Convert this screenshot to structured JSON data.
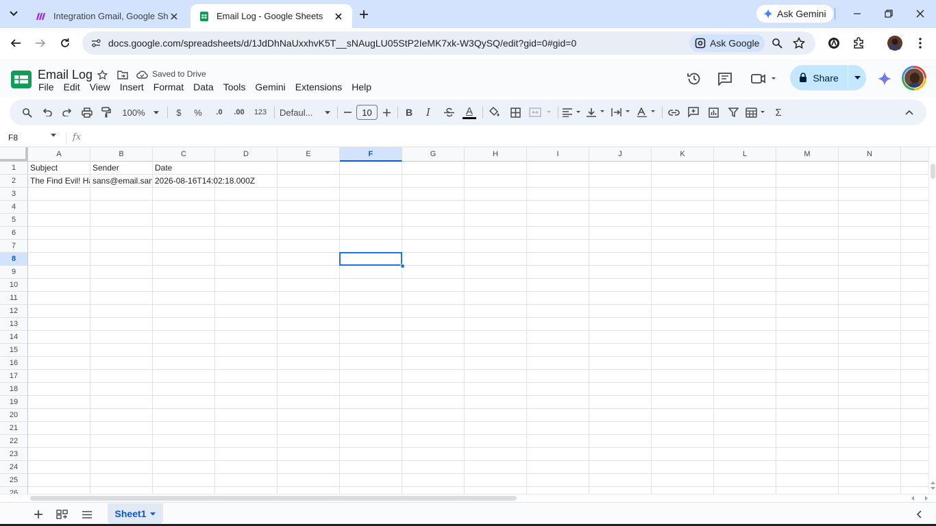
{
  "browser": {
    "tabs": [
      {
        "title": "Integration Gmail, Google Shee",
        "active": false
      },
      {
        "title": "Email Log - Google Sheets",
        "active": true
      }
    ],
    "ask_gemini": "Ask Gemini",
    "url": "docs.google.com/spreadsheets/d/1JdDhNaUxxhvK5T__sNAugLU05StP2IeMK7xk-W3QySQ/edit?gid=0#gid=0",
    "ask_google": "Ask Google"
  },
  "doc": {
    "title": "Email Log",
    "saved_status": "Saved to Drive",
    "menu": [
      "File",
      "Edit",
      "View",
      "Insert",
      "Format",
      "Data",
      "Tools",
      "Gemini",
      "Extensions",
      "Help"
    ],
    "share_label": "Share"
  },
  "toolbar": {
    "zoom": "100%",
    "currency": "$",
    "percent": "%",
    "decrease_decimal": ".0",
    "increase_decimal": ".00",
    "number_format": "123",
    "font": "Defaul...",
    "font_size": "10",
    "bold": "B",
    "italic": "I",
    "text_color_glyph": "A",
    "sum_glyph": "Σ"
  },
  "formula_bar": {
    "name_box": "F8",
    "fx": "fx",
    "value": ""
  },
  "grid": {
    "columns": [
      "A",
      "B",
      "C",
      "D",
      "E",
      "F",
      "G",
      "H",
      "I",
      "J",
      "K",
      "L",
      "M",
      "N"
    ],
    "rows": [
      "1",
      "2",
      "3",
      "4",
      "5",
      "6",
      "7",
      "8",
      "9",
      "10",
      "11",
      "12",
      "13",
      "14",
      "15",
      "16",
      "17",
      "18",
      "19",
      "20",
      "21",
      "22",
      "23",
      "24",
      "25",
      "26"
    ],
    "selected_cell": "F8",
    "cells": {
      "A1": "Subject",
      "B1": "Sender",
      "C1": "Date",
      "A2": "The Find Evil! Ha",
      "B2": "sans@email.san",
      "C2": "2026-08-16T14:02:18.000Z"
    }
  },
  "sheets": [
    {
      "name": "Sheet1",
      "active": true
    }
  ],
  "colors": {
    "accent": "#0b57d0",
    "selection": "#1a73e8",
    "share_bg": "#c2e7ff",
    "tabstrip_bg": "#d3e3fd"
  }
}
